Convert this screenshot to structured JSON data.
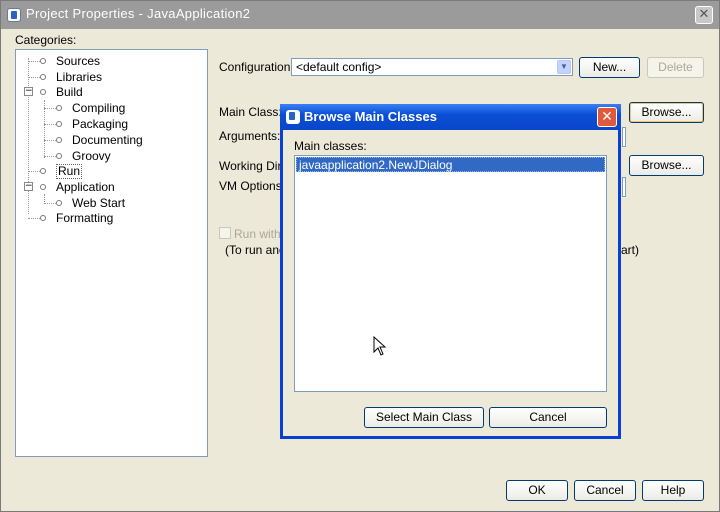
{
  "window": {
    "title": "Project Properties - JavaApplication2"
  },
  "categories": {
    "label": "Categories:",
    "items": [
      {
        "label": "Sources"
      },
      {
        "label": "Libraries"
      },
      {
        "label": "Build"
      },
      {
        "label": "Compiling"
      },
      {
        "label": "Packaging"
      },
      {
        "label": "Documenting"
      },
      {
        "label": "Groovy"
      },
      {
        "label": "Run"
      },
      {
        "label": "Application"
      },
      {
        "label": "Web Start"
      },
      {
        "label": "Formatting"
      }
    ]
  },
  "config": {
    "label": "Configuration:",
    "value": "<default config>",
    "new_label": "New...",
    "delete_label": "Delete"
  },
  "run": {
    "main_class_label": "Main Class:",
    "browse_label": "Browse...",
    "arguments_label": "Arguments:",
    "working_dir_label": "Working Dire",
    "working_browse_label": "Browse...",
    "vm_options_label": "VM Options:",
    "run_with_label": "Run with",
    "note_left": "(To run and",
    "note_right": "art)"
  },
  "footer": {
    "ok": "OK",
    "cancel": "Cancel",
    "help": "Help"
  },
  "dialog": {
    "title": "Browse Main Classes",
    "main_classes_label": "Main classes:",
    "selected_item": "javaapplication2.NewJDialog",
    "select_button": "Select Main Class",
    "cancel_button": "Cancel"
  }
}
